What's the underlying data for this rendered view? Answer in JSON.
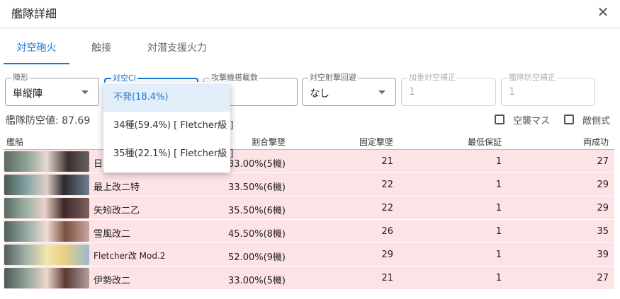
{
  "dialog": {
    "title": "艦隊詳細"
  },
  "tabs": [
    {
      "label": "対空砲火"
    },
    {
      "label": "触接"
    },
    {
      "label": "対潜支援火力"
    }
  ],
  "fields": {
    "formation": {
      "label": "陣形",
      "value": "単縦陣"
    },
    "cutin": {
      "label": "対空CI",
      "value": ""
    },
    "planes": {
      "label": "攻撃機搭載数",
      "value": ""
    },
    "evasion": {
      "label": "対空射撃回避",
      "value": "なし"
    },
    "weighted": {
      "label": "加重対空補正",
      "value": "1"
    },
    "fleet_aa": {
      "label": "艦隊防空補正",
      "value": "1"
    }
  },
  "fleet_aa_value": "艦隊防空値: 87.69",
  "checkboxes": {
    "air_raid": "空襲マス",
    "enemy_side": "敵側式"
  },
  "table": {
    "headers": [
      "艦船",
      "割合撃墜",
      "固定撃墜",
      "最低保証",
      "両成功"
    ],
    "rows": [
      {
        "name": "日",
        "ratio": "33.00%(5機)",
        "fixed": "21",
        "min": "1",
        "both": "27"
      },
      {
        "name": "最上改二特",
        "ratio": "33.50%(6機)",
        "fixed": "22",
        "min": "1",
        "both": "29"
      },
      {
        "name": "矢矧改二乙",
        "ratio": "35.50%(6機)",
        "fixed": "22",
        "min": "1",
        "both": "29"
      },
      {
        "name": "雪風改二",
        "ratio": "45.50%(8機)",
        "fixed": "26",
        "min": "1",
        "both": "35"
      },
      {
        "name": "Fletcher改 Mod.2",
        "ratio": "52.00%(9機)",
        "fixed": "29",
        "min": "1",
        "both": "39"
      },
      {
        "name": "伊勢改二",
        "ratio": "33.00%(5機)",
        "fixed": "21",
        "min": "1",
        "both": "27"
      }
    ]
  },
  "dropdown": {
    "options": [
      "不発(18.4%)",
      "34種(59.4%) [ Fletcher級 ]",
      "35種(22.1%) [ Fletcher級 ]"
    ]
  },
  "colors": {
    "accent": "#1976d2",
    "row_bg": "#fde3e6"
  }
}
